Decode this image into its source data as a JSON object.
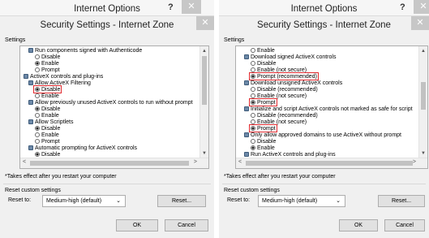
{
  "outer_title": "Internet Options",
  "help_glyph": "?",
  "close_glyph": "✕",
  "dialog_title": "Security Settings - Internet Zone",
  "settings_label": "Settings",
  "footer_note": "*Takes effect after you restart your computer",
  "reset_section_label": "Reset custom settings",
  "reset_to_label": "Reset to:",
  "reset_select_value": "Medium-high (default)",
  "reset_button": "Reset...",
  "ok_button": "OK",
  "cancel_button": "Cancel",
  "left_settings": [
    {
      "icon": "gear",
      "label": "Run components signed with Authenticode",
      "indent": 1
    },
    {
      "icon": "radio-off",
      "label": "Disable",
      "indent": 2
    },
    {
      "icon": "radio-on",
      "label": "Enable",
      "indent": 2
    },
    {
      "icon": "radio-off",
      "label": "Prompt",
      "indent": 2
    },
    {
      "icon": "gear",
      "label": "ActiveX controls and plug-ins",
      "indent": 0
    },
    {
      "icon": "gear",
      "label": "Allow ActiveX Filtering",
      "indent": 1
    },
    {
      "icon": "radio-on",
      "label": "Disable",
      "indent": 2,
      "highlight": true
    },
    {
      "icon": "radio-off",
      "label": "Enable",
      "indent": 2
    },
    {
      "icon": "gear",
      "label": "Allow previously unused ActiveX controls to run without prompt",
      "indent": 1
    },
    {
      "icon": "radio-on",
      "label": "Disable",
      "indent": 2
    },
    {
      "icon": "radio-off",
      "label": "Enable",
      "indent": 2
    },
    {
      "icon": "gear",
      "label": "Allow Scriptlets",
      "indent": 1
    },
    {
      "icon": "radio-on",
      "label": "Disable",
      "indent": 2
    },
    {
      "icon": "radio-off",
      "label": "Enable",
      "indent": 2
    },
    {
      "icon": "radio-off",
      "label": "Prompt",
      "indent": 2
    },
    {
      "icon": "gear",
      "label": "Automatic prompting for ActiveX controls",
      "indent": 1
    },
    {
      "icon": "radio-on",
      "label": "Disable",
      "indent": 2
    }
  ],
  "right_settings": [
    {
      "icon": "radio-off",
      "label": "Enable",
      "indent": 2
    },
    {
      "icon": "gear",
      "label": "Download signed ActiveX controls",
      "indent": 1
    },
    {
      "icon": "radio-off",
      "label": "Disable",
      "indent": 2
    },
    {
      "icon": "radio-off",
      "label": "Enable (not secure)",
      "indent": 2
    },
    {
      "icon": "radio-on",
      "label": "Prompt (recommended)",
      "indent": 2,
      "highlight": true
    },
    {
      "icon": "gear",
      "label": "Download unsigned ActiveX controls",
      "indent": 1
    },
    {
      "icon": "radio-off",
      "label": "Disable (recommended)",
      "indent": 2
    },
    {
      "icon": "radio-off",
      "label": "Enable (not secure)",
      "indent": 2
    },
    {
      "icon": "radio-on",
      "label": "Prompt",
      "indent": 2,
      "highlight": true
    },
    {
      "icon": "gear",
      "label": "Initialize and script ActiveX controls not marked as safe for script",
      "indent": 1
    },
    {
      "icon": "radio-off",
      "label": "Disable (recommended)",
      "indent": 2
    },
    {
      "icon": "radio-off",
      "label": "Enable (not secure)",
      "indent": 2
    },
    {
      "icon": "radio-on",
      "label": "Prompt",
      "indent": 2,
      "highlight": true
    },
    {
      "icon": "gear",
      "label": "Only allow approved domains to use ActiveX without prompt",
      "indent": 1
    },
    {
      "icon": "radio-off",
      "label": "Disable",
      "indent": 2
    },
    {
      "icon": "radio-on",
      "label": "Enable",
      "indent": 2
    },
    {
      "icon": "gear",
      "label": "Run ActiveX controls and plug-ins",
      "indent": 1
    }
  ]
}
